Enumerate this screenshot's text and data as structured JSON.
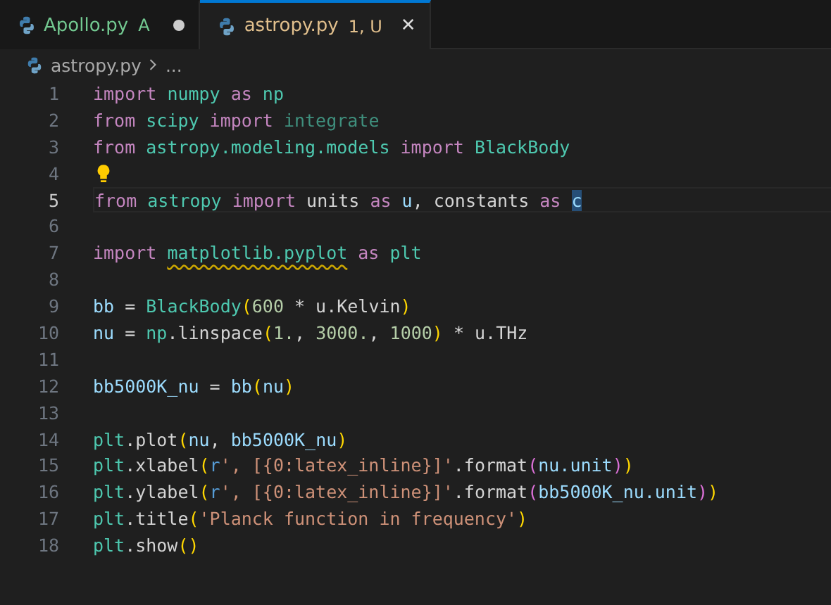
{
  "tabs": [
    {
      "label": "Apollo.py",
      "status": "A",
      "color": "#73c991",
      "selected": false,
      "dirty": true
    },
    {
      "label": "astropy.py",
      "status": "1, U",
      "color": "#e2c08d",
      "selected": true,
      "dirty": false
    }
  ],
  "close_glyph": "✕",
  "breadcrumb": {
    "file": "astropy.py",
    "rest": "..."
  },
  "lines": [
    {
      "number": "1",
      "current": false,
      "lightbulb": false,
      "tokens": [
        {
          "text": "import ",
          "kind": "k"
        },
        {
          "text": "numpy ",
          "kind": "m"
        },
        {
          "text": "as ",
          "kind": "k"
        },
        {
          "text": "np",
          "kind": "m"
        }
      ]
    },
    {
      "number": "2",
      "current": false,
      "lightbulb": false,
      "tokens": [
        {
          "text": "from ",
          "kind": "k"
        },
        {
          "text": "scipy ",
          "kind": "m"
        },
        {
          "text": "import ",
          "kind": "k"
        },
        {
          "text": "integrate",
          "kind": "u"
        }
      ]
    },
    {
      "number": "3",
      "current": false,
      "lightbulb": false,
      "tokens": [
        {
          "text": "from ",
          "kind": "k"
        },
        {
          "text": "astropy.modeling.models ",
          "kind": "m"
        },
        {
          "text": "import ",
          "kind": "k"
        },
        {
          "text": "BlackBody",
          "kind": "m"
        }
      ]
    },
    {
      "number": "4",
      "current": false,
      "lightbulb": true
    },
    {
      "number": "5",
      "current": true,
      "lightbulb": false,
      "tokens": [
        {
          "text": "from ",
          "kind": "k"
        },
        {
          "text": "astropy ",
          "kind": "m"
        },
        {
          "text": "import",
          "kind": "k"
        },
        {
          "text": " units ",
          "kind": "p"
        },
        {
          "text": "as ",
          "kind": "k"
        },
        {
          "text": "u",
          "kind": "v"
        },
        {
          "text": ", constants ",
          "kind": "p"
        },
        {
          "text": "as ",
          "kind": "k"
        },
        {
          "text": "c",
          "kind": "sel"
        }
      ]
    },
    {
      "number": "6",
      "current": false,
      "lightbulb": false
    },
    {
      "number": "7",
      "current": false,
      "lightbulb": false,
      "tokens": [
        {
          "text": "import ",
          "kind": "k"
        },
        {
          "text": "matplotlib.pyplot",
          "kind": "w"
        },
        {
          "text": " as ",
          "kind": "k"
        },
        {
          "text": "plt",
          "kind": "m"
        }
      ]
    },
    {
      "number": "8",
      "current": false,
      "lightbulb": false
    },
    {
      "number": "9",
      "current": false,
      "lightbulb": false,
      "tokens": [
        {
          "text": "bb",
          "kind": "v"
        },
        {
          "text": " = ",
          "kind": "p"
        },
        {
          "text": "BlackBody",
          "kind": "m"
        },
        {
          "text": "(",
          "kind": "b1"
        },
        {
          "text": "600",
          "kind": "n"
        },
        {
          "text": " * u.Kelvin",
          "kind": "p"
        },
        {
          "text": ")",
          "kind": "b1"
        }
      ]
    },
    {
      "number": "10",
      "current": false,
      "lightbulb": false,
      "tokens": [
        {
          "text": "nu",
          "kind": "v"
        },
        {
          "text": " = ",
          "kind": "p"
        },
        {
          "text": "np",
          "kind": "m"
        },
        {
          "text": ".linspace",
          "kind": "p"
        },
        {
          "text": "(",
          "kind": "b1"
        },
        {
          "text": "1.",
          "kind": "n"
        },
        {
          "text": ", ",
          "kind": "p"
        },
        {
          "text": "3000.",
          "kind": "n"
        },
        {
          "text": ", ",
          "kind": "p"
        },
        {
          "text": "1000",
          "kind": "n"
        },
        {
          "text": ")",
          "kind": "b1"
        },
        {
          "text": " * u.THz",
          "kind": "p"
        }
      ]
    },
    {
      "number": "11",
      "current": false,
      "lightbulb": false
    },
    {
      "number": "12",
      "current": false,
      "lightbulb": false,
      "tokens": [
        {
          "text": "bb5000K_nu",
          "kind": "v"
        },
        {
          "text": " = ",
          "kind": "p"
        },
        {
          "text": "bb",
          "kind": "v"
        },
        {
          "text": "(",
          "kind": "b1"
        },
        {
          "text": "nu",
          "kind": "v"
        },
        {
          "text": ")",
          "kind": "b1"
        }
      ]
    },
    {
      "number": "13",
      "current": false,
      "lightbulb": false
    },
    {
      "number": "14",
      "current": false,
      "lightbulb": false,
      "tokens": [
        {
          "text": "plt",
          "kind": "m"
        },
        {
          "text": ".plot",
          "kind": "p"
        },
        {
          "text": "(",
          "kind": "b1"
        },
        {
          "text": "nu",
          "kind": "v"
        },
        {
          "text": ", ",
          "kind": "p"
        },
        {
          "text": "bb5000K_nu",
          "kind": "v"
        },
        {
          "text": ")",
          "kind": "b1"
        }
      ]
    },
    {
      "number": "15",
      "current": false,
      "lightbulb": false,
      "tokens": [
        {
          "text": "plt",
          "kind": "m"
        },
        {
          "text": ".xlabel",
          "kind": "p"
        },
        {
          "text": "(",
          "kind": "b1"
        },
        {
          "text": "r",
          "kind": "r"
        },
        {
          "text": "', [{0:latex_inline}]'",
          "kind": "s"
        },
        {
          "text": ".format",
          "kind": "p"
        },
        {
          "text": "(",
          "kind": "b2"
        },
        {
          "text": "nu.unit",
          "kind": "v"
        },
        {
          "text": ")",
          "kind": "b2"
        },
        {
          "text": ")",
          "kind": "b1"
        }
      ]
    },
    {
      "number": "16",
      "current": false,
      "lightbulb": false,
      "tokens": [
        {
          "text": "plt",
          "kind": "m"
        },
        {
          "text": ".ylabel",
          "kind": "p"
        },
        {
          "text": "(",
          "kind": "b1"
        },
        {
          "text": "r",
          "kind": "r"
        },
        {
          "text": "', [{0:latex_inline}]'",
          "kind": "s"
        },
        {
          "text": ".format",
          "kind": "p"
        },
        {
          "text": "(",
          "kind": "b2"
        },
        {
          "text": "bb5000K_nu.unit",
          "kind": "v"
        },
        {
          "text": ")",
          "kind": "b2"
        },
        {
          "text": ")",
          "kind": "b1"
        }
      ]
    },
    {
      "number": "17",
      "current": false,
      "lightbulb": false,
      "tokens": [
        {
          "text": "plt",
          "kind": "m"
        },
        {
          "text": ".title",
          "kind": "p"
        },
        {
          "text": "(",
          "kind": "b1"
        },
        {
          "text": "'Planck function in frequency'",
          "kind": "s"
        },
        {
          "text": ")",
          "kind": "b1"
        }
      ]
    },
    {
      "number": "18",
      "current": false,
      "lightbulb": false,
      "tokens": [
        {
          "text": "plt",
          "kind": "m"
        },
        {
          "text": ".show",
          "kind": "p"
        },
        {
          "text": "()",
          "kind": "b1"
        }
      ]
    }
  ]
}
